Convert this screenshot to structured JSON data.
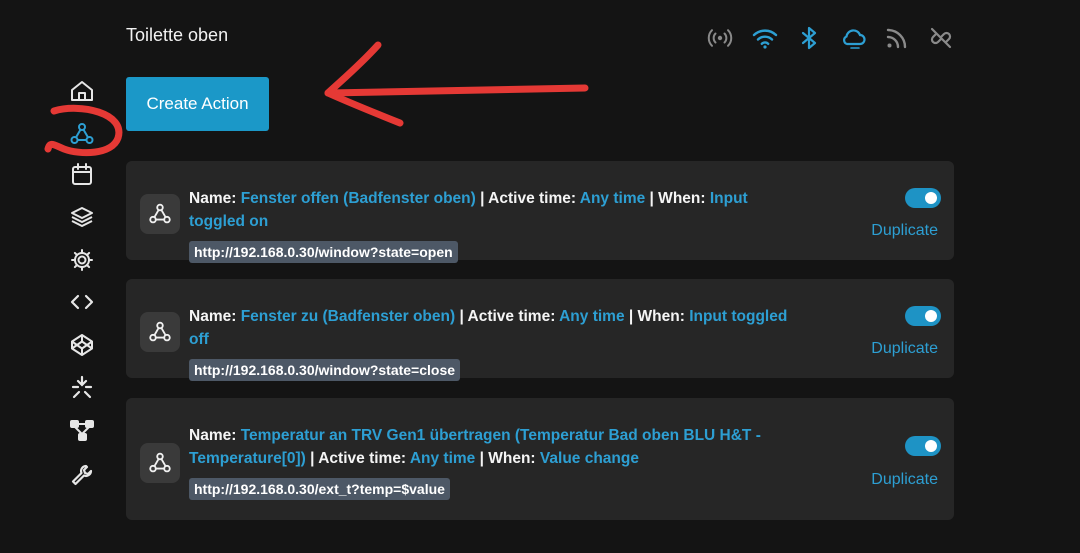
{
  "header": {
    "title": "Toilette oben"
  },
  "status_icons": [
    "broadcast-icon",
    "wifi-icon",
    "bluetooth-icon",
    "cloud-icon",
    "rss-icon",
    "link-off-icon"
  ],
  "toolbar": {
    "create_label": "Create Action"
  },
  "sidebar": {
    "items": [
      "home-icon",
      "webhook-icon",
      "calendar-icon",
      "layers-icon",
      "gear-icon",
      "code-icon",
      "codepen-icon",
      "scripts-icon",
      "network-icon",
      "wrench-icon"
    ],
    "active": "webhook-icon"
  },
  "labels": {
    "name": "Name: ",
    "active_time": " | Active time: ",
    "when": " | When: ",
    "duplicate": "Duplicate"
  },
  "actions": [
    {
      "name": "Fenster offen (Badfenster oben)",
      "active_time": "Any time",
      "when": "Input toggled on",
      "url": "http://192.168.0.30/window?state=open",
      "enabled": true
    },
    {
      "name": "Fenster zu (Badfenster oben)",
      "active_time": "Any time",
      "when": "Input toggled off",
      "url": "http://192.168.0.30/window?state=close",
      "enabled": true
    },
    {
      "name": "Temperatur an TRV Gen1 übertragen (Temperatur Bad oben BLU H&T - Temperature[0])",
      "active_time": "Any time",
      "when": "Value change",
      "url": "http://192.168.0.30/ext_t?temp=$value",
      "enabled": true
    }
  ],
  "colors": {
    "accent": "#1b98c8",
    "link": "#2d9fd3",
    "annotation": "#e53935",
    "background": "#141414",
    "card": "#262626"
  }
}
